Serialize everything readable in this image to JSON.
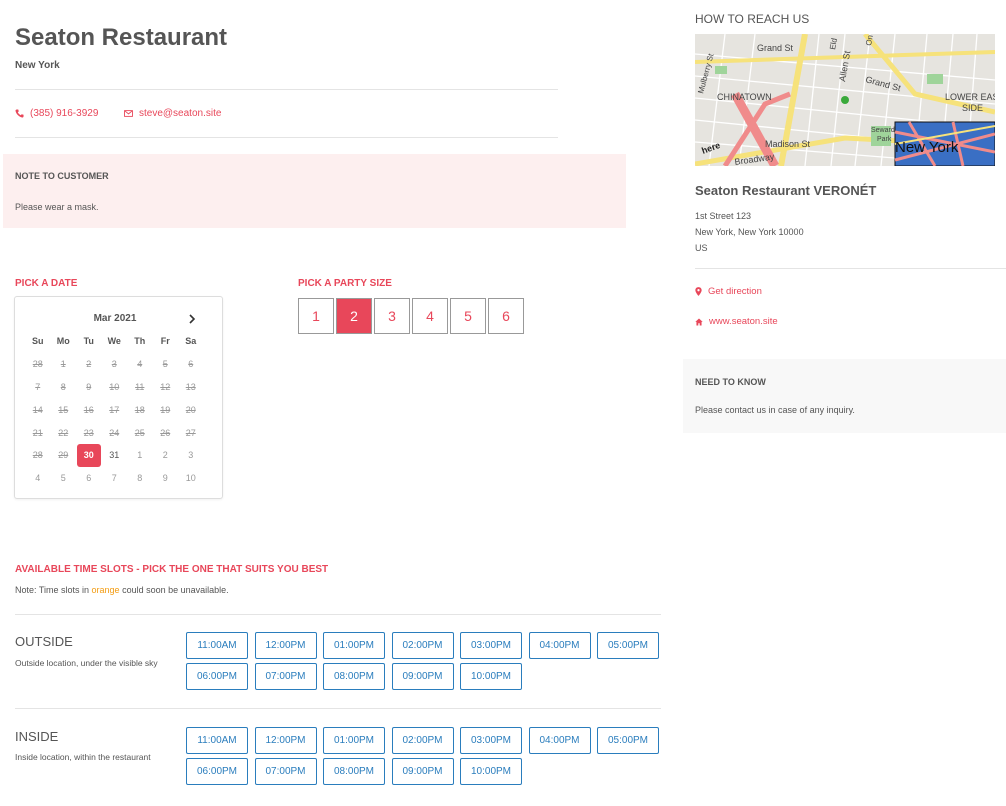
{
  "restaurant": {
    "name": "Seaton Restaurant",
    "city": "New York",
    "phone": "(385) 916-3929",
    "email": "steve@seaton.site"
  },
  "note": {
    "title": "NOTE TO CUSTOMER",
    "text": "Please wear a mask."
  },
  "date_picker": {
    "label": "PICK A DATE",
    "month": "Mar 2021",
    "weekdays": [
      "Su",
      "Mo",
      "Tu",
      "We",
      "Th",
      "Fr",
      "Sa"
    ],
    "days": [
      {
        "d": "28",
        "s": "disabled"
      },
      {
        "d": "1",
        "s": "disabled"
      },
      {
        "d": "2",
        "s": "disabled"
      },
      {
        "d": "3",
        "s": "disabled"
      },
      {
        "d": "4",
        "s": "disabled"
      },
      {
        "d": "5",
        "s": "disabled"
      },
      {
        "d": "6",
        "s": "disabled"
      },
      {
        "d": "7",
        "s": "disabled"
      },
      {
        "d": "8",
        "s": "disabled"
      },
      {
        "d": "9",
        "s": "disabled"
      },
      {
        "d": "10",
        "s": "disabled"
      },
      {
        "d": "11",
        "s": "disabled"
      },
      {
        "d": "12",
        "s": "disabled"
      },
      {
        "d": "13",
        "s": "disabled"
      },
      {
        "d": "14",
        "s": "disabled"
      },
      {
        "d": "15",
        "s": "disabled"
      },
      {
        "d": "16",
        "s": "disabled"
      },
      {
        "d": "17",
        "s": "disabled"
      },
      {
        "d": "18",
        "s": "disabled"
      },
      {
        "d": "19",
        "s": "disabled"
      },
      {
        "d": "20",
        "s": "disabled"
      },
      {
        "d": "21",
        "s": "disabled"
      },
      {
        "d": "22",
        "s": "disabled"
      },
      {
        "d": "23",
        "s": "disabled"
      },
      {
        "d": "24",
        "s": "disabled"
      },
      {
        "d": "25",
        "s": "disabled"
      },
      {
        "d": "26",
        "s": "disabled"
      },
      {
        "d": "27",
        "s": "disabled"
      },
      {
        "d": "28",
        "s": "disabled"
      },
      {
        "d": "29",
        "s": "disabled"
      },
      {
        "d": "30",
        "s": "selected"
      },
      {
        "d": "31",
        "s": "normal"
      },
      {
        "d": "1",
        "s": "other"
      },
      {
        "d": "2",
        "s": "other"
      },
      {
        "d": "3",
        "s": "other"
      },
      {
        "d": "4",
        "s": "other"
      },
      {
        "d": "5",
        "s": "other"
      },
      {
        "d": "6",
        "s": "other"
      },
      {
        "d": "7",
        "s": "other"
      },
      {
        "d": "8",
        "s": "other"
      },
      {
        "d": "9",
        "s": "other"
      },
      {
        "d": "10",
        "s": "other"
      }
    ]
  },
  "party": {
    "label": "PICK A PARTY SIZE",
    "sizes": [
      "1",
      "2",
      "3",
      "4",
      "5",
      "6"
    ],
    "selected": "2"
  },
  "slots": {
    "heading": "AVAILABLE TIME SLOTS - PICK THE ONE THAT SUITS YOU BEST",
    "note_prefix": "Note: Time slots in ",
    "note_highlight": "orange",
    "note_suffix": " could soon be unavailable.",
    "zones": [
      {
        "title": "OUTSIDE",
        "desc": "Outside location, under the visible sky",
        "times": [
          "11:00AM",
          "12:00PM",
          "01:00PM",
          "02:00PM",
          "03:00PM",
          "04:00PM",
          "05:00PM",
          "06:00PM",
          "07:00PM",
          "08:00PM",
          "09:00PM",
          "10:00PM"
        ]
      },
      {
        "title": "INSIDE",
        "desc": "Inside location, within the restaurant",
        "times": [
          "11:00AM",
          "12:00PM",
          "01:00PM",
          "02:00PM",
          "03:00PM",
          "04:00PM",
          "05:00PM",
          "06:00PM",
          "07:00PM",
          "08:00PM",
          "09:00PM",
          "10:00PM"
        ]
      }
    ]
  },
  "reach": {
    "title": "HOW TO REACH US",
    "map_labels": {
      "grand_st": "Grand St",
      "grand_st_2": "Grand St",
      "chinatown": "CHINATOWN",
      "lower_east": "LOWER EAS",
      "side": "SIDE",
      "mulberry": "Mulberry St",
      "allen": "Allen St",
      "madison": "Madison St",
      "broadway": "Broadway",
      "seward": "Seward",
      "park": "Park",
      "here": "here",
      "new_york": "New York",
      "el": "Eld",
      "on": "On"
    },
    "venue": "Seaton Restaurant VERONÉT",
    "address": [
      "1st Street 123",
      "New York, New York 10000",
      "US"
    ],
    "direction": "Get direction",
    "website": "www.seaton.site"
  },
  "need_to_know": {
    "title": "NEED TO KNOW",
    "text": "Please contact us in case of any inquiry."
  },
  "colors": {
    "accent": "#e8475a",
    "slot": "#2a7dbd",
    "note_bg": "#fdefef",
    "orange": "#f39c12"
  }
}
